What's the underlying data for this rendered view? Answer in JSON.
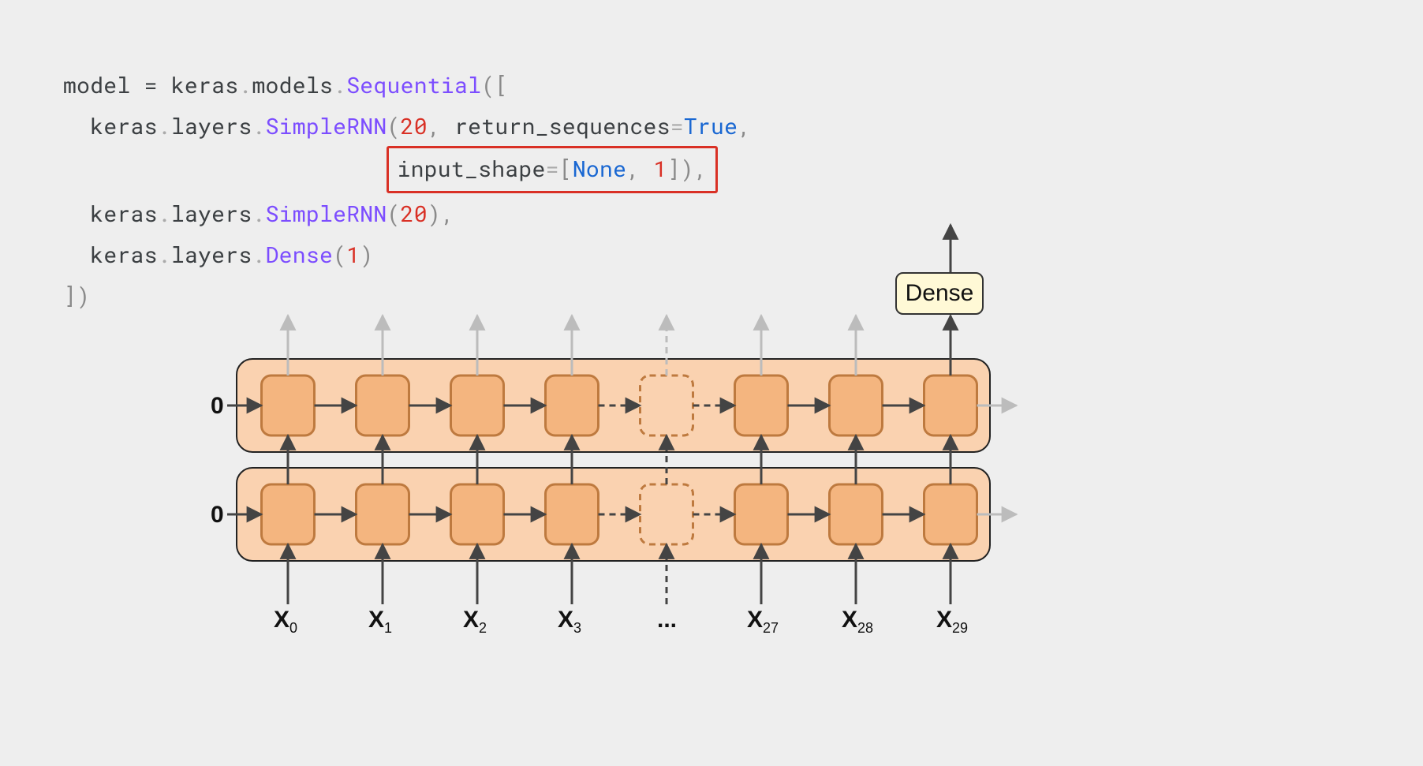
{
  "code": {
    "l1_model": "model",
    "l1_eq": " = ",
    "l1_keras": "keras",
    "l1_models": "models",
    "l1_seq": "Sequential",
    "l1_open": "([",
    "l2_keras": "keras",
    "l2_layers": "layers",
    "l2_rnn": "SimpleRNN",
    "l2_20": "20",
    "l2_retseq": "return_sequences",
    "l2_true": "True",
    "hl_input_shape": "input_shape",
    "hl_none": "None",
    "hl_one": "1",
    "l3_keras": "keras",
    "l3_layers": "layers",
    "l3_rnn": "SimpleRNN",
    "l3_20": "20",
    "l4_keras": "keras",
    "l4_layers": "layers",
    "l4_dense": "Dense",
    "l4_one": "1",
    "l5_close": "])"
  },
  "diagram": {
    "dense_label": "Dense",
    "zero_top": "0",
    "zero_bot": "0",
    "ellipsis": "...",
    "inputs": [
      "X",
      "X",
      "X",
      "X",
      "...",
      "X",
      "X",
      "X"
    ],
    "input_subs": [
      "0",
      "1",
      "2",
      "3",
      "",
      "27",
      "28",
      "29"
    ],
    "n_positions": 8,
    "colors": {
      "band_fill": "#fad2b0",
      "band_stroke": "#222222",
      "cell_fill": "#f4b57f",
      "cell_stroke": "#be7a3f",
      "arrow_dark": "#444444",
      "arrow_light": "#bcbcbc"
    }
  }
}
